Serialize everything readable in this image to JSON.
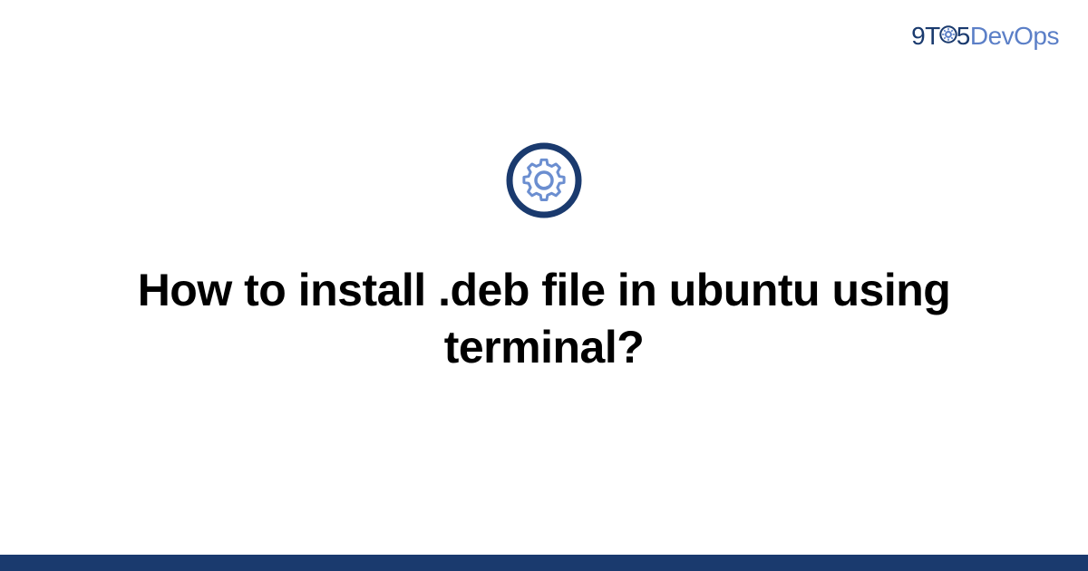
{
  "brand": {
    "part1": "9T",
    "part2": "5",
    "part3": "DevOps"
  },
  "headline": "How to install .deb file in ubuntu using terminal?",
  "colors": {
    "accent_dark": "#1a3a6e",
    "accent_light": "#5b7fc7"
  }
}
